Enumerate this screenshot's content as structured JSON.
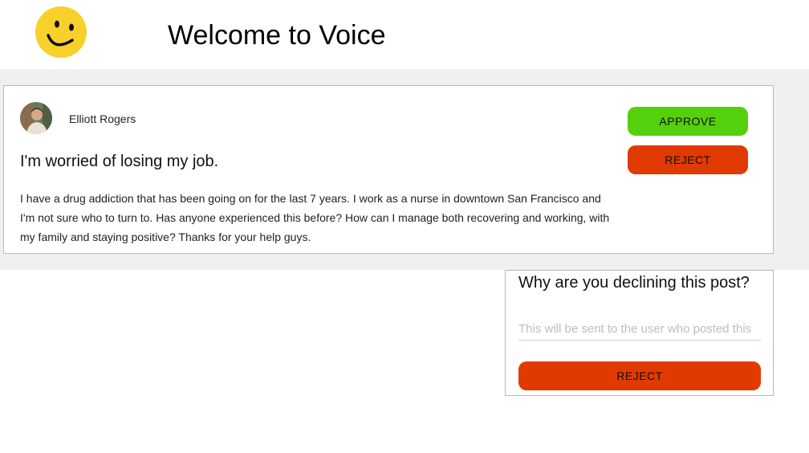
{
  "header": {
    "logo_icon": "smiley-icon",
    "title": "Welcome to Voice"
  },
  "colors": {
    "approve": "#55d00d",
    "reject": "#e03a00",
    "logo_yellow": "#f7d02c",
    "band_background": "#efefef"
  },
  "post": {
    "author": "Elliott Rogers",
    "avatar_icon": "user-avatar",
    "title": "I'm worried of losing my job.",
    "body": "I have a drug addiction that has been going on for the last 7 years. I work as a nurse in downtown San Francisco and I'm not sure who to turn to. Has anyone experienced this before? How can I manage both recovering and working, with my family and staying positive? Thanks for your help guys.",
    "approve_label": "APPROVE",
    "reject_label": "REJECT"
  },
  "decline": {
    "question": "Why are you declining this post?",
    "placeholder": "This will be sent to the user who posted this",
    "value": "",
    "reject_label": "REJECT"
  }
}
